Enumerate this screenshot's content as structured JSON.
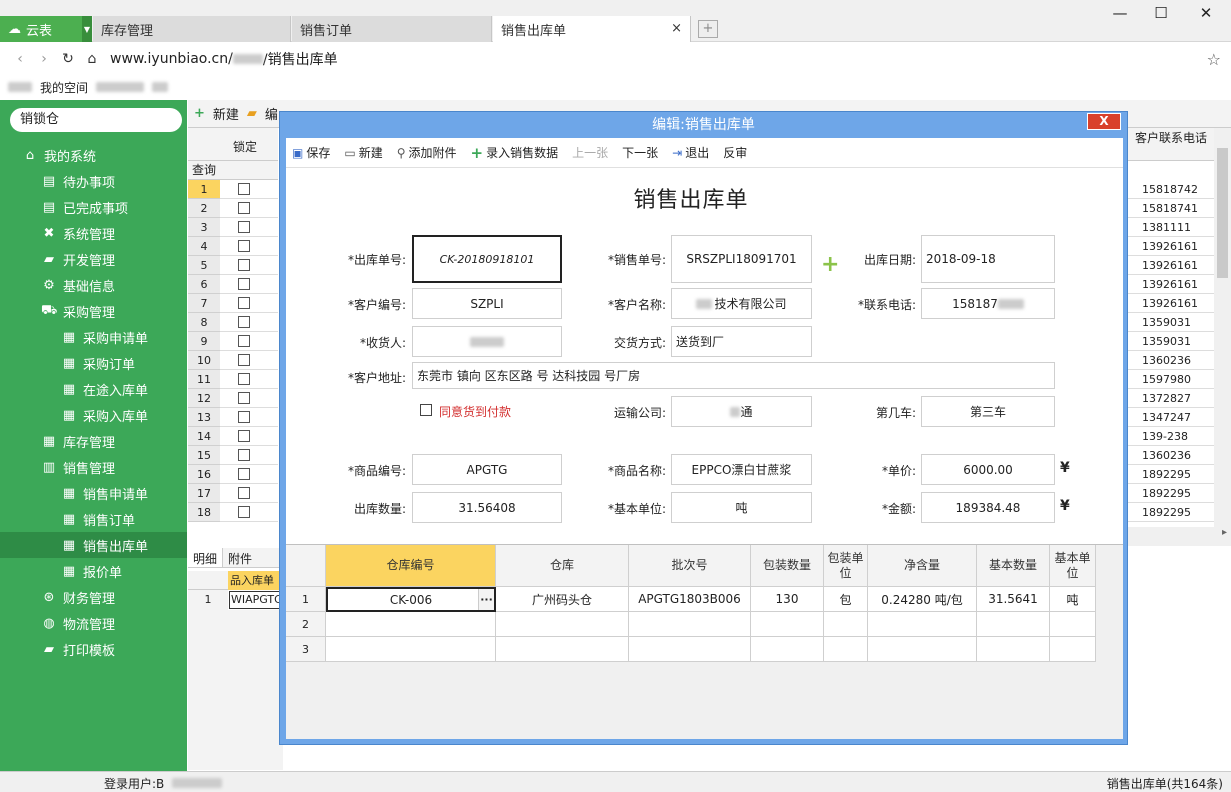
{
  "app": {
    "name": "云表"
  },
  "tabs": [
    {
      "label": "库存管理"
    },
    {
      "label": "销售订单"
    },
    {
      "label": "销售出库单",
      "close": "×"
    }
  ],
  "address": {
    "url_prefix": "www.iyunbiao.cn/",
    "url_suffix": "/销售出库单"
  },
  "bookmarks": {
    "my_space": "我的空间"
  },
  "sidebar": {
    "search_value": "销锁仓",
    "items": [
      {
        "label": "我的系统"
      },
      {
        "label": "待办事项"
      },
      {
        "label": "已完成事项"
      },
      {
        "label": "系统管理"
      },
      {
        "label": "开发管理"
      },
      {
        "label": "基础信息"
      },
      {
        "label": "采购管理"
      },
      {
        "label": "采购申请单"
      },
      {
        "label": "采购订单"
      },
      {
        "label": "在途入库单"
      },
      {
        "label": "采购入库单"
      },
      {
        "label": "库存管理"
      },
      {
        "label": "销售管理"
      },
      {
        "label": "销售申请单"
      },
      {
        "label": "销售订单"
      },
      {
        "label": "销售出库单"
      },
      {
        "label": "报价单"
      },
      {
        "label": "财务管理"
      },
      {
        "label": "物流管理"
      },
      {
        "label": "打印模板"
      }
    ]
  },
  "bg": {
    "toolbar_new": "新建",
    "toolbar_edit": "编",
    "col_lock": "锁定",
    "query": "查询",
    "right_col_header": "客户联系电话",
    "rows": [
      "1",
      "2",
      "3",
      "4",
      "5",
      "6",
      "7",
      "8",
      "9",
      "10",
      "11",
      "12",
      "13",
      "14",
      "15",
      "16",
      "17",
      "18"
    ],
    "phones": [
      "15818742",
      "15818741",
      "1381111",
      "13926161",
      "13926161",
      "13926161",
      "13926161",
      "1359031",
      "1359031",
      "1360236",
      "1597980",
      "1372827",
      "1347247",
      "139-238",
      "1360236",
      "1892295",
      "1892295",
      "1892295"
    ],
    "detail_tab": "明细",
    "attach_tab": "附件",
    "bottom_header": "品入库单",
    "bottom_row_no": "1",
    "bottom_cell": "WIAPGTG"
  },
  "status": {
    "login": "登录用户:B",
    "count": "销售出库单(共164条)"
  },
  "dialog": {
    "title": "编辑:销售出库单",
    "close": "X",
    "toolbar": {
      "save": "保存",
      "new": "新建",
      "attach": "添加附件",
      "enter_sales": "录入销售数据",
      "prev": "上一张",
      "next": "下一张",
      "exit": "退出",
      "unaudit": "反审"
    },
    "form_title": "销售出库单",
    "labels": {
      "out_no": "*出库单号:",
      "sales_no": "*销售单号:",
      "out_date": "出库日期:",
      "cust_code": "*客户编号:",
      "cust_name": "*客户名称:",
      "phone": "*联系电话:",
      "receiver": "*收货人:",
      "delivery": "交货方式:",
      "address": "*客户地址:",
      "cod": "同意货到付款",
      "transport": "运输公司:",
      "which_car": "第几车:",
      "prod_code": "*商品编号:",
      "prod_name": "*商品名称:",
      "unit_price": "*单价:",
      "qty": "出库数量:",
      "base_unit": "*基本单位:",
      "amount": "*金额:"
    },
    "values": {
      "out_no": "CK-20180918101",
      "sales_no": "SRSZPLI18091701",
      "out_date": "2018-09-18",
      "cust_code": "SZPLI",
      "cust_name": "技术有限公司",
      "phone": "158187",
      "receiver": "",
      "delivery": "送货到厂",
      "address": "东莞市 镇向 区东区路 号 达科技园 号厂房",
      "transport": "通",
      "which_car": "第三车",
      "prod_code": "APGTG",
      "prod_name": "EPPCO漂白甘蔗浆",
      "unit_price": "6000.00",
      "qty": "31.56408",
      "base_unit": "吨",
      "amount": "189384.48",
      "yen": "¥"
    },
    "grid": {
      "headers": [
        "仓库编号",
        "仓库",
        "批次号",
        "包装数量",
        "包装单位",
        "净含量",
        "基本数量",
        "基本单位"
      ],
      "rows": [
        {
          "no": "1",
          "cells": [
            "CK-006",
            "广州码头仓",
            "APGTG1803B006",
            "130",
            "包",
            "0.24280  吨/包",
            "31.5641",
            "吨"
          ]
        },
        {
          "no": "2",
          "cells": [
            "",
            "",
            "",
            "",
            "",
            "",
            "",
            ""
          ]
        },
        {
          "no": "3",
          "cells": [
            "",
            "",
            "",
            "",
            "",
            "",
            "",
            ""
          ]
        }
      ],
      "ellipsis": "···"
    }
  }
}
